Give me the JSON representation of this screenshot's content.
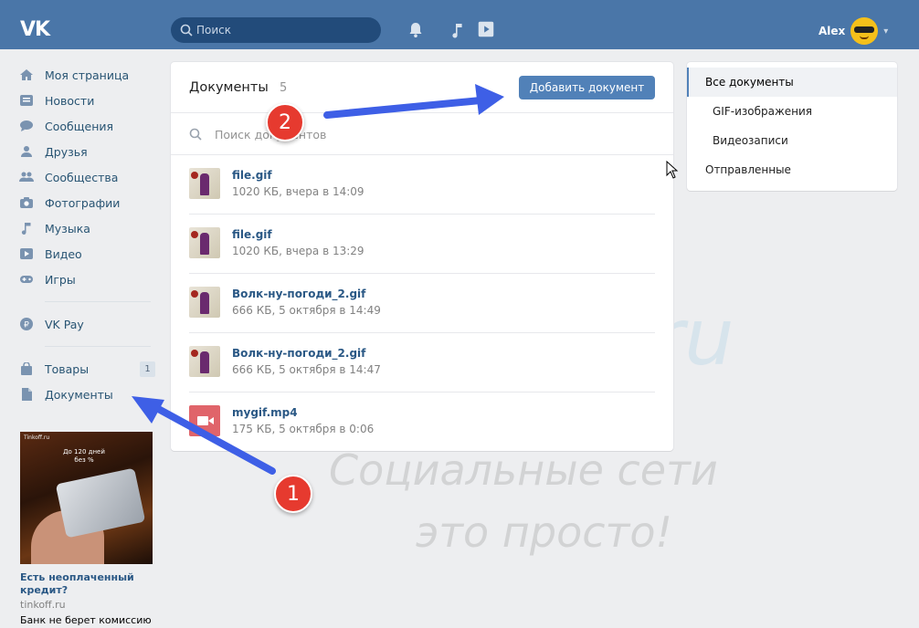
{
  "header": {
    "logo": "VK",
    "search_placeholder": "Поиск",
    "user_name": "Alex"
  },
  "sidebar": {
    "items": [
      {
        "label": "Моя страница",
        "icon": "home-icon"
      },
      {
        "label": "Новости",
        "icon": "news-icon"
      },
      {
        "label": "Сообщения",
        "icon": "messages-icon"
      },
      {
        "label": "Друзья",
        "icon": "friends-icon"
      },
      {
        "label": "Сообщества",
        "icon": "communities-icon"
      },
      {
        "label": "Фотографии",
        "icon": "camera-icon"
      },
      {
        "label": "Музыка",
        "icon": "music-icon"
      },
      {
        "label": "Видео",
        "icon": "video-icon"
      },
      {
        "label": "Игры",
        "icon": "gamepad-icon"
      }
    ],
    "vkpay": {
      "label": "VK Pay",
      "icon": "vkpay-icon"
    },
    "goods": {
      "label": "Товары",
      "badge": "1",
      "icon": "bag-icon"
    },
    "documents": {
      "label": "Документы",
      "icon": "document-icon"
    }
  },
  "ad": {
    "brand": "Tinkoff.ru",
    "promo": "До 120 дней без %",
    "title": "Есть неоплаченный кредит?",
    "domain": "tinkoff.ru",
    "text": "Банк не берет комиссию"
  },
  "main": {
    "title": "Документы",
    "count": "5",
    "add_button": "Добавить документ",
    "search_placeholder": "Поиск документов",
    "docs": [
      {
        "name": "file.gif",
        "meta": "1020 КБ, вчера в 14:09",
        "type": "gif"
      },
      {
        "name": "file.gif",
        "meta": "1020 КБ, вчера в 13:29",
        "type": "gif"
      },
      {
        "name": "Волк-ну-погоди_2.gif",
        "meta": "666 КБ, 5 октября в 14:49",
        "type": "gif"
      },
      {
        "name": "Волк-ну-погоди_2.gif",
        "meta": "666 КБ, 5 октября в 14:47",
        "type": "gif"
      },
      {
        "name": "mygif.mp4",
        "meta": "175 КБ, 5 октября в 0:06",
        "type": "video"
      }
    ]
  },
  "filters": {
    "all": "Все документы",
    "gif": "GIF-изображения",
    "video": "Видеозаписи",
    "sent": "Отправленные"
  },
  "watermark": {
    "line1": "Soc-FAQ.ru",
    "line2": "Социальные сети",
    "line3": "это просто!"
  },
  "annotations": {
    "marker1": "1",
    "marker2": "2"
  },
  "colors": {
    "header_bg": "#4a76a8",
    "accent": "#5181b8",
    "link": "#2a5885",
    "marker_red": "#e63a2f",
    "arrow_blue": "#3e5fe6"
  }
}
